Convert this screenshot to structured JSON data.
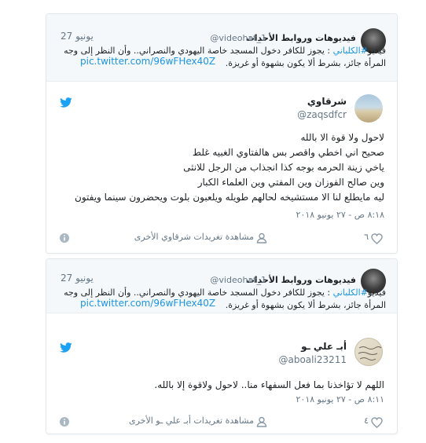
{
  "colors": {
    "accent": "#1b95e0",
    "muted": "#657786",
    "text": "#1c2022",
    "border": "#e1e8ed",
    "quote_bg": "#f5f8fa"
  },
  "cards": [
    {
      "quote": {
        "author_name": "فيديوهات وروابط الأحداث",
        "author_handle": "@videohat_1",
        "date": "27 يونيو",
        "line1_prefix": "فيديو",
        "hashtag": "#الكلباني",
        "line1_rest": " : يجوز للكافر دخول المسجد خاصة اليهودي والنصراني.. وأن النظر إلى وجه",
        "line2": "المرأة جائز، بشرط ألا يكون بشهوة أو غريزة.",
        "link": "pic.twitter.com/96wFHex40Z"
      },
      "main": {
        "author_name": "شرقاوي",
        "author_handle": "@zaqsdfcr",
        "avatar_icon": "beach-photo-avatar",
        "lines": [
          "لاحول ولا قوة الا بالله",
          "صحيح اني اخطي واقصر بس هالفتاوي الغبيه غلط",
          "ياخي زينة الحرمه بوجه كذا انجذاب من الرجل للانثى",
          "وين صالح الفوزان وين المفتي وين العلماء الكبار",
          "ليه مايطلع لنا الا مستشيخه لحالهم طويله ويلعبون بلوت ويحضرون سينما ويفتون"
        ],
        "timestamp": "٨:١٨ ص - ٢٧ يونيو ٢٠١٨",
        "likes": "٦",
        "more_text": "مشاهدة تغريدات شرقاوي الأخرى"
      }
    },
    {
      "quote": {
        "author_name": "فيديوهات وروابط الأحداث",
        "author_handle": "@videohat_1",
        "date": "27 يونيو",
        "line1_prefix": "فيديو",
        "hashtag": "#الكلباني",
        "line1_rest": " : يجوز للكافر دخول المسجد خاصة اليهودي والنصراني.. وأن النظر إلى وجه",
        "line2": "المرأة جائز، بشرط ألا يكون بشهوة أو غريزة.",
        "link": "pic.twitter.com/96wFHex40Z"
      },
      "main": {
        "author_name": "أبـ علي ـو",
        "author_handle": "@aboali23211",
        "avatar_icon": "handwriting-avatar",
        "lines": [
          "اللهم لا تؤاخذنا بما فعل السفهاء منا.. لاحول ولاقوة إلا بالله."
        ],
        "timestamp": "٨:١١ ص - ٢٧ يونيو ٢٠١٨",
        "likes": "٤",
        "more_text": "مشاهدة تغريدات أبـ علي ـو الأخرى"
      }
    }
  ]
}
